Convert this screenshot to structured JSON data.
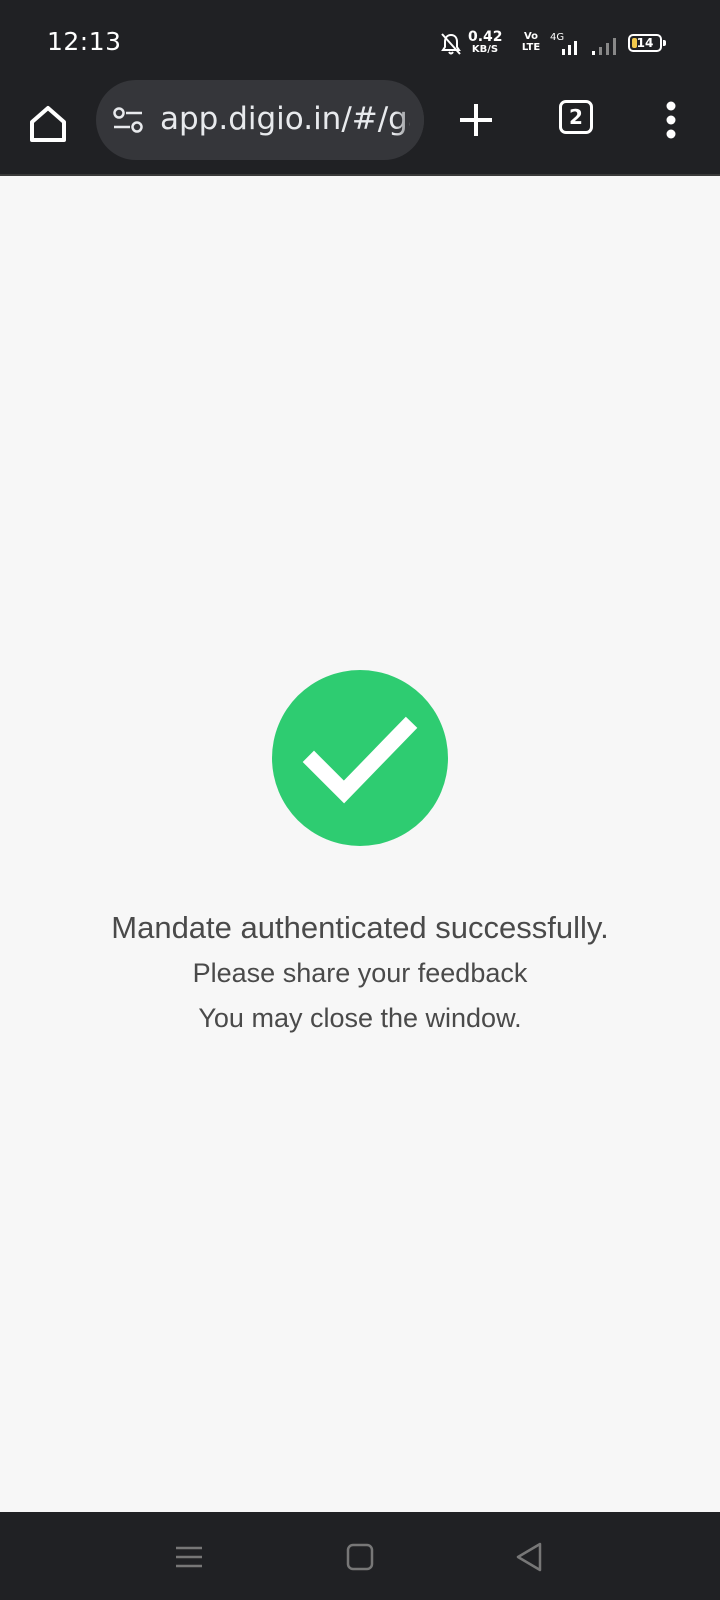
{
  "status_bar": {
    "time": "12:13",
    "net_speed_value": "0.42",
    "net_speed_unit": "KB/S",
    "volte_top": "Vo",
    "volte_bottom": "LTE",
    "network_type": "4G",
    "battery_level": "14",
    "icons": [
      "bell-off-icon",
      "signal-icon",
      "battery-icon"
    ]
  },
  "toolbar": {
    "url": "app.digio.in/#/gat",
    "tab_count": "2",
    "icons": [
      "home-icon",
      "tune-icon",
      "plus-icon",
      "tabs-icon",
      "more-vert-icon"
    ]
  },
  "main": {
    "message": "Mandate authenticated successfully.",
    "feedback_text": "Please share your feedback",
    "close_text": "You may close the window.",
    "success_color": "#2ecc71"
  },
  "nav_bar": {
    "icons": [
      "recents-icon",
      "home-nav-icon",
      "back-icon"
    ]
  }
}
